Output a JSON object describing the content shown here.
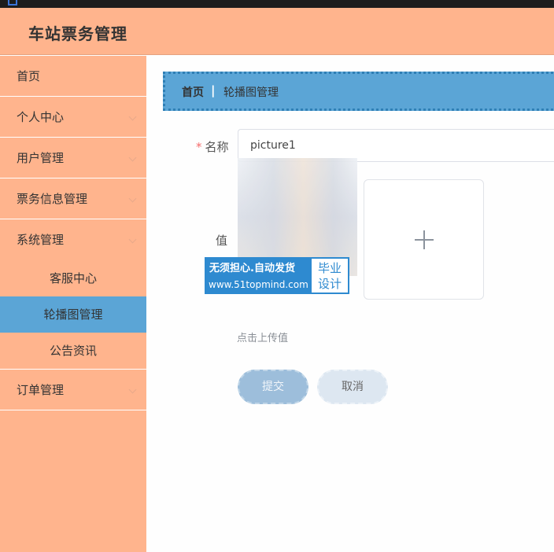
{
  "app": {
    "title": "车站票务管理"
  },
  "sidebar": {
    "items": [
      {
        "label": "首页",
        "has_arrow": false
      },
      {
        "label": "个人中心",
        "has_arrow": true
      },
      {
        "label": "用户管理",
        "has_arrow": true
      },
      {
        "label": "票务信息管理",
        "has_arrow": true
      },
      {
        "label": "系统管理",
        "has_arrow": true,
        "open": true
      },
      {
        "label": "订单管理",
        "has_arrow": true
      }
    ],
    "sub_items": [
      {
        "label": "客服中心",
        "active": false
      },
      {
        "label": "轮播图管理",
        "active": true
      },
      {
        "label": "公告资讯",
        "active": false
      }
    ]
  },
  "breadcrumb": {
    "home": "首页",
    "separator": "|",
    "current": "轮播图管理"
  },
  "form": {
    "name_label": "名称",
    "required_mark": "*",
    "name_value": "picture1",
    "value_label": "值",
    "upload_hint": "点击上传值",
    "submit_label": "提交",
    "cancel_label": "取消"
  },
  "watermark": {
    "line1": "无须担心.自动发货",
    "line2": "www.51topmind.com",
    "badge_line1": "毕业",
    "badge_line2": "设计"
  },
  "colors": {
    "header_bg": "#ffb48d",
    "sidebar_bg": "#ffb48d",
    "active_bg": "#5ba5d6",
    "breadcrumb_bg": "#5ba5d6",
    "required": "#f56c6c"
  },
  "icons": [
    "chevron-down-icon",
    "plus-icon"
  ]
}
